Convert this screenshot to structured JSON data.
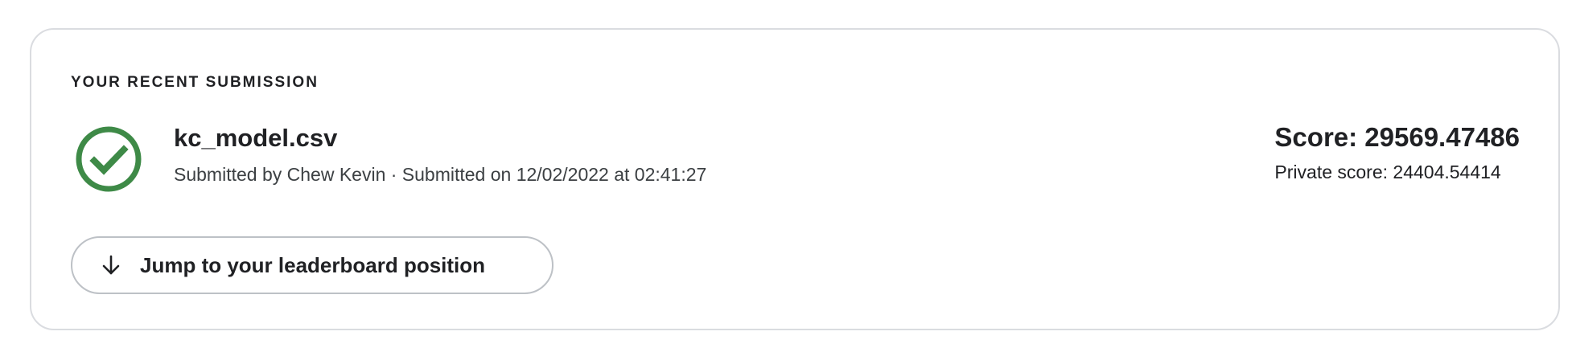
{
  "submission": {
    "section_title": "YOUR RECENT SUBMISSION",
    "status_icon": "check-circle-icon",
    "status_color": "#3e8a47",
    "file_name": "kc_model.csv",
    "meta": "Submitted by Chew Kevin · Submitted on 12/02/2022 at 02:41:27",
    "score": "Score: 29569.47486",
    "private_score": "Private score: 24404.54414",
    "jump_button": {
      "icon": "arrow-down-icon",
      "label": "Jump to your leaderboard position"
    }
  }
}
